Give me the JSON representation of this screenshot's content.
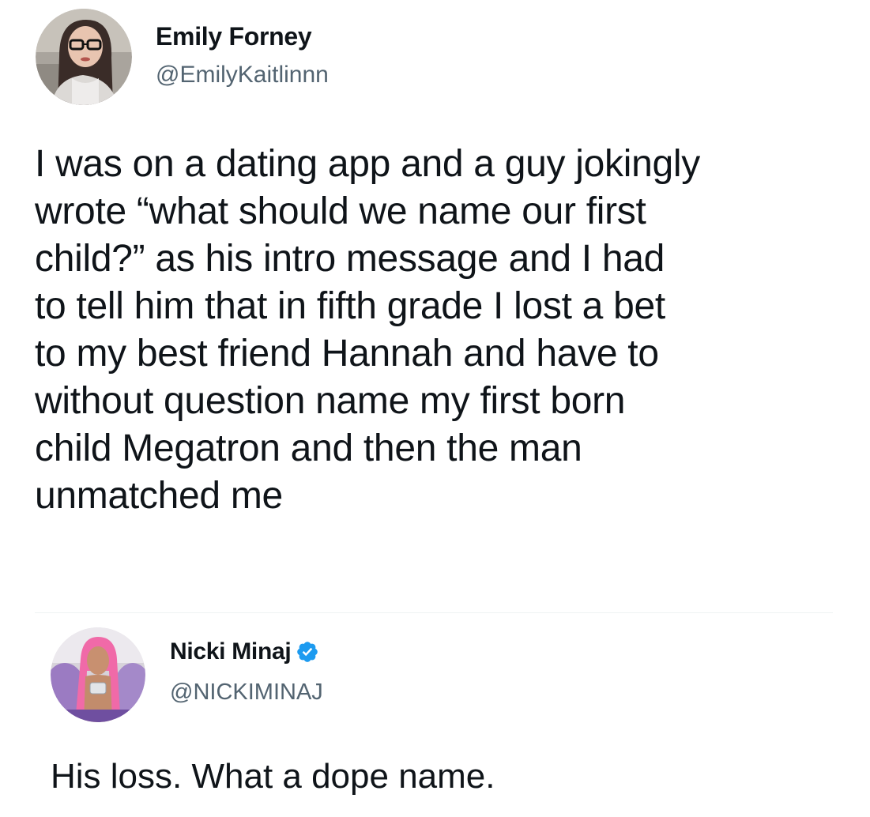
{
  "tweets": [
    {
      "author_name": "Emily Forney",
      "author_handle": "@EmilyKaitlinnn",
      "avatar_icon": "profile-photo",
      "text": "I was on a dating app and a guy jokingly\nwrote “what should we name our first\nchild?” as his intro message and I had\nto tell him that in fifth grade I lost a bet\nto my best friend Hannah and have to\nwithout question name my first born\nchild Megatron and then the man\nunmatched me"
    },
    {
      "author_name": "Nicki Minaj",
      "author_handle": "@NICKIMINAJ",
      "avatar_icon": "profile-photo",
      "verified_icon": "verified-badge-icon",
      "text": "His loss. What a dope name."
    }
  ],
  "colors": {
    "text_primary": "#0f1419",
    "text_secondary": "#536471",
    "verified_blue": "#1d9bf0",
    "background": "#ffffff"
  }
}
